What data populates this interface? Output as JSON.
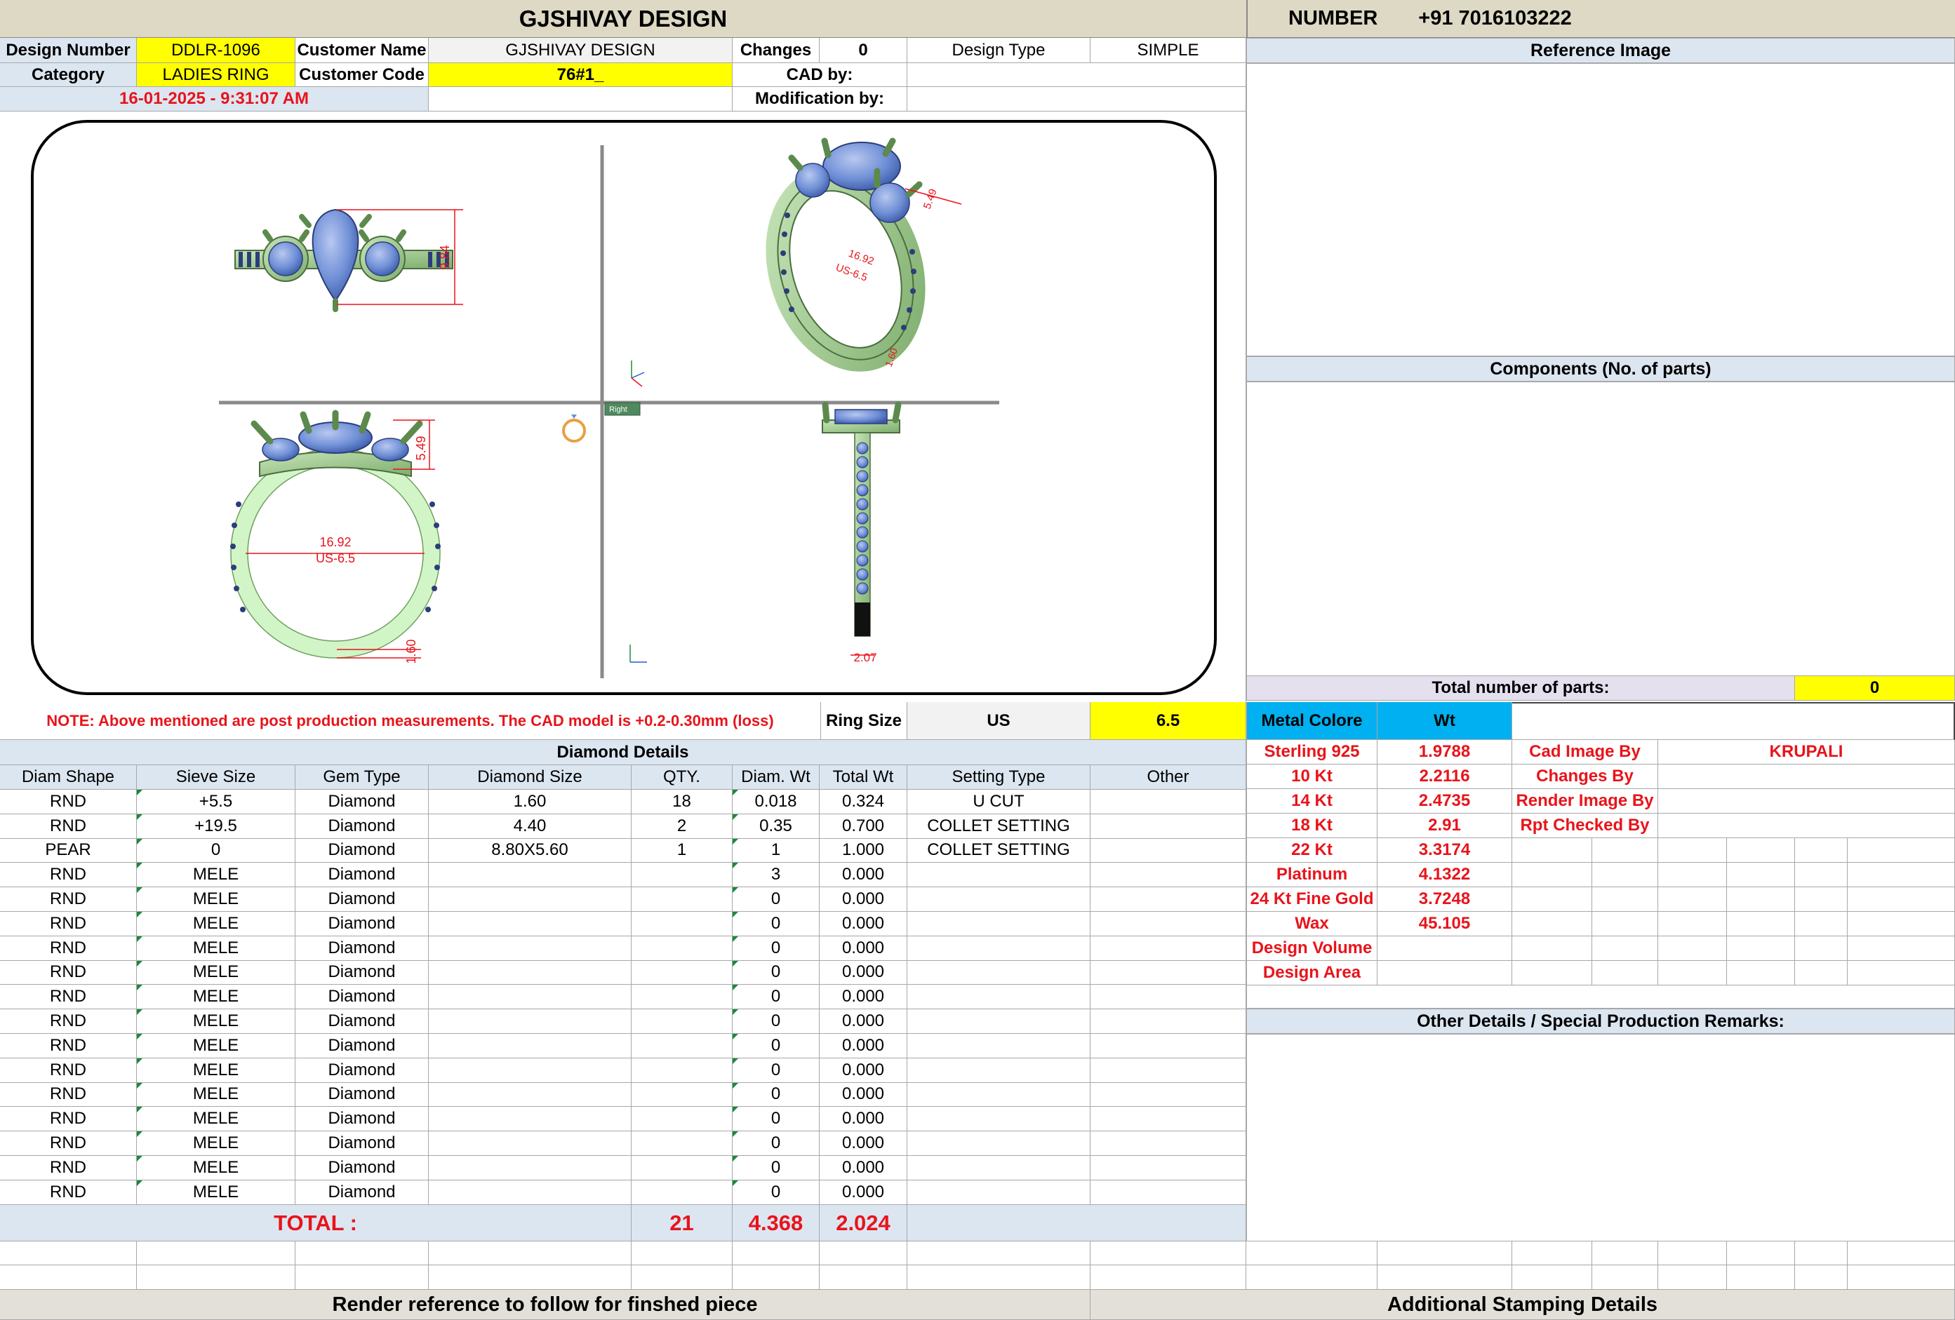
{
  "header": {
    "title": "GJSHIVAY DESIGN",
    "number_label": "NUMBER",
    "number_value": "+91 7016103222"
  },
  "info": {
    "design_number_label": "Design Number",
    "design_number": "DDLR-1096",
    "customer_name_label": "Customer Name",
    "customer_name": "GJSHIVAY DESIGN",
    "changes_label": "Changes",
    "changes": "0",
    "design_type_label": "Design Type",
    "design_type": "SIMPLE",
    "category_label": "Category",
    "category": "LADIES RING",
    "customer_code_label": "Customer Code",
    "customer_code": "76#1_",
    "cad_by_label": "CAD by:",
    "cad_by": "",
    "timestamp": "16-01-2025 - 9:31:07 AM",
    "modification_by_label": "Modification by:",
    "modification_by": ""
  },
  "drawing": {
    "dim_top_height": "9.84",
    "dim_persp_head": "5.49",
    "dim_persp_ring": "16.92",
    "dim_persp_size": "US-6.5",
    "dim_persp_shank": "1.60",
    "dim_front_head": "5.49",
    "dim_front_ring": "16.92",
    "dim_front_size": "US-6.5",
    "dim_front_shank": "1.60",
    "dim_side_width": "2.07",
    "view_button": "Right"
  },
  "right_panels": {
    "reference_image": "Reference Image",
    "components": "Components (No. of parts)",
    "total_parts_label": "Total number of parts:",
    "total_parts": "0",
    "other_details": "Other Details / Special Production Remarks:"
  },
  "note": "NOTE: Above mentioned are post production measurements. The CAD model is +0.2-0.30mm (loss)",
  "ring_size": {
    "label": "Ring Size",
    "system": "US",
    "value": "6.5"
  },
  "metal": {
    "header_metal": "Metal Colore",
    "header_wt": "Wt",
    "rows": [
      {
        "name": "Sterling 925",
        "wt": "1.9788"
      },
      {
        "name": "10 Kt",
        "wt": "2.2116"
      },
      {
        "name": "14 Kt",
        "wt": "2.4735"
      },
      {
        "name": "18 Kt",
        "wt": "2.91"
      },
      {
        "name": "22 Kt",
        "wt": "3.3174"
      },
      {
        "name": "Platinum",
        "wt": "4.1322"
      },
      {
        "name": "24 Kt Fine Gold",
        "wt": "3.7248"
      },
      {
        "name": "Wax",
        "wt": "45.105"
      },
      {
        "name": "Design Volume",
        "wt": ""
      },
      {
        "name": "Design Area",
        "wt": ""
      }
    ]
  },
  "people": [
    {
      "label": "Cad Image By",
      "value": "KRUPALI"
    },
    {
      "label": "Changes By",
      "value": ""
    },
    {
      "label": "Render Image By",
      "value": ""
    },
    {
      "label": "Rpt Checked By",
      "value": ""
    }
  ],
  "diamond": {
    "title": "Diamond Details",
    "headers": [
      "Diam Shape",
      "Sieve Size",
      "Gem Type",
      "Diamond Size",
      "QTY.",
      "Diam. Wt",
      "Total Wt",
      "Setting Type",
      "Other"
    ],
    "rows": [
      [
        "RND",
        "+5.5",
        "Diamond",
        "1.60",
        "18",
        "0.018",
        "0.324",
        "U CUT",
        ""
      ],
      [
        "RND",
        "+19.5",
        "Diamond",
        "4.40",
        "2",
        "0.35",
        "0.700",
        "COLLET SETTING",
        ""
      ],
      [
        "PEAR",
        "0",
        "Diamond",
        "8.80X5.60",
        "1",
        "1",
        "1.000",
        "COLLET SETTING",
        ""
      ],
      [
        "RND",
        "MELE",
        "Diamond",
        "",
        "",
        "3",
        "0.000",
        "",
        ""
      ],
      [
        "RND",
        "MELE",
        "Diamond",
        "",
        "",
        "0",
        "0.000",
        "",
        ""
      ],
      [
        "RND",
        "MELE",
        "Diamond",
        "",
        "",
        "0",
        "0.000",
        "",
        ""
      ],
      [
        "RND",
        "MELE",
        "Diamond",
        "",
        "",
        "0",
        "0.000",
        "",
        ""
      ],
      [
        "RND",
        "MELE",
        "Diamond",
        "",
        "",
        "0",
        "0.000",
        "",
        ""
      ],
      [
        "RND",
        "MELE",
        "Diamond",
        "",
        "",
        "0",
        "0.000",
        "",
        ""
      ],
      [
        "RND",
        "MELE",
        "Diamond",
        "",
        "",
        "0",
        "0.000",
        "",
        ""
      ],
      [
        "RND",
        "MELE",
        "Diamond",
        "",
        "",
        "0",
        "0.000",
        "",
        ""
      ],
      [
        "RND",
        "MELE",
        "Diamond",
        "",
        "",
        "0",
        "0.000",
        "",
        ""
      ],
      [
        "RND",
        "MELE",
        "Diamond",
        "",
        "",
        "0",
        "0.000",
        "",
        ""
      ],
      [
        "RND",
        "MELE",
        "Diamond",
        "",
        "",
        "0",
        "0.000",
        "",
        ""
      ],
      [
        "RND",
        "MELE",
        "Diamond",
        "",
        "",
        "0",
        "0.000",
        "",
        ""
      ],
      [
        "RND",
        "MELE",
        "Diamond",
        "",
        "",
        "0",
        "0.000",
        "",
        ""
      ],
      [
        "RND",
        "MELE",
        "Diamond",
        "",
        "",
        "0",
        "0.000",
        "",
        ""
      ]
    ],
    "total_label": "TOTAL :",
    "total_qty": "21",
    "total_diam_wt": "4.368",
    "total_wt": "2.024"
  },
  "footer": {
    "render_reference": "Render reference to follow for finshed piece",
    "stamping": "Additional Stamping Details"
  },
  "colors": {
    "yellow": "#ffff00",
    "red_text": "#e8141b",
    "header_blue": "#dce6f1",
    "metal_header": "#00b0f0",
    "ring_green": "#a9d59a",
    "gem_blue": "#6f8fd6"
  }
}
